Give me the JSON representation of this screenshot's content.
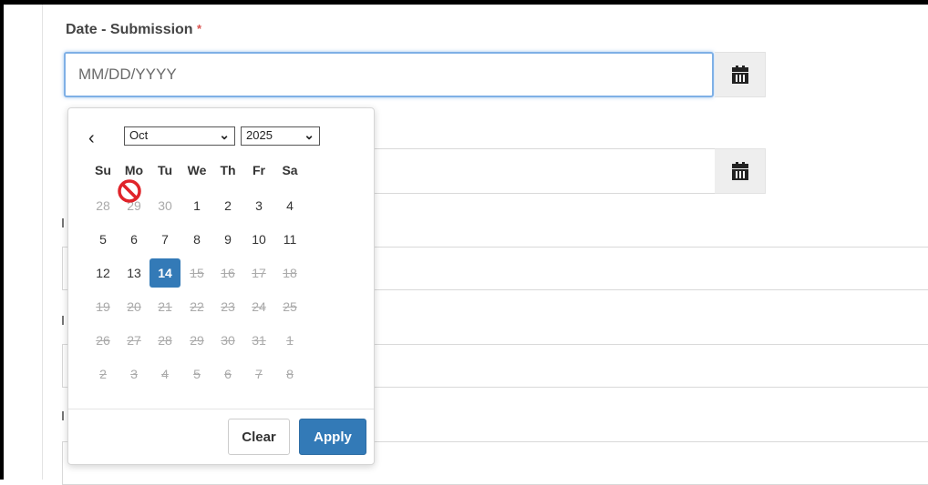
{
  "form": {
    "field_label": "Date - Submission",
    "required_mark": "*",
    "date_input": {
      "placeholder": "MM/DD/YYYY",
      "value": ""
    }
  },
  "icons": {
    "calendar": "calendar-icon",
    "prev": "chevron-left-icon",
    "dropdown": "chevron-down-icon",
    "cursor": "not-allowed-cursor-icon"
  },
  "colors": {
    "accent": "#337ab7",
    "focus_border": "#7fb0e6",
    "cursor_red": "#e0242a"
  },
  "datepicker": {
    "prev_glyph": "‹",
    "month": "Oct",
    "year": "2025",
    "weekdays": [
      "Su",
      "Mo",
      "Tu",
      "We",
      "Th",
      "Fr",
      "Sa"
    ],
    "weeks": [
      [
        {
          "d": "28",
          "s": "muted"
        },
        {
          "d": "29",
          "s": "muted"
        },
        {
          "d": "30",
          "s": "muted"
        },
        {
          "d": "1",
          "s": ""
        },
        {
          "d": "2",
          "s": ""
        },
        {
          "d": "3",
          "s": ""
        },
        {
          "d": "4",
          "s": ""
        }
      ],
      [
        {
          "d": "5",
          "s": ""
        },
        {
          "d": "6",
          "s": ""
        },
        {
          "d": "7",
          "s": ""
        },
        {
          "d": "8",
          "s": ""
        },
        {
          "d": "9",
          "s": ""
        },
        {
          "d": "10",
          "s": ""
        },
        {
          "d": "11",
          "s": ""
        }
      ],
      [
        {
          "d": "12",
          "s": ""
        },
        {
          "d": "13",
          "s": ""
        },
        {
          "d": "14",
          "s": "selected"
        },
        {
          "d": "15",
          "s": "disabled"
        },
        {
          "d": "16",
          "s": "disabled"
        },
        {
          "d": "17",
          "s": "disabled"
        },
        {
          "d": "18",
          "s": "disabled"
        }
      ],
      [
        {
          "d": "19",
          "s": "disabled"
        },
        {
          "d": "20",
          "s": "disabled"
        },
        {
          "d": "21",
          "s": "disabled"
        },
        {
          "d": "22",
          "s": "disabled"
        },
        {
          "d": "23",
          "s": "disabled"
        },
        {
          "d": "24",
          "s": "disabled"
        },
        {
          "d": "25",
          "s": "disabled"
        }
      ],
      [
        {
          "d": "26",
          "s": "disabled"
        },
        {
          "d": "27",
          "s": "disabled"
        },
        {
          "d": "28",
          "s": "disabled"
        },
        {
          "d": "29",
          "s": "disabled"
        },
        {
          "d": "30",
          "s": "disabled"
        },
        {
          "d": "31",
          "s": "disabled"
        },
        {
          "d": "1",
          "s": "disabled"
        }
      ],
      [
        {
          "d": "2",
          "s": "disabled"
        },
        {
          "d": "3",
          "s": "disabled"
        },
        {
          "d": "4",
          "s": "disabled"
        },
        {
          "d": "5",
          "s": "disabled"
        },
        {
          "d": "6",
          "s": "disabled"
        },
        {
          "d": "7",
          "s": "disabled"
        },
        {
          "d": "8",
          "s": "disabled"
        }
      ]
    ],
    "clear_label": "Clear",
    "apply_label": "Apply"
  }
}
